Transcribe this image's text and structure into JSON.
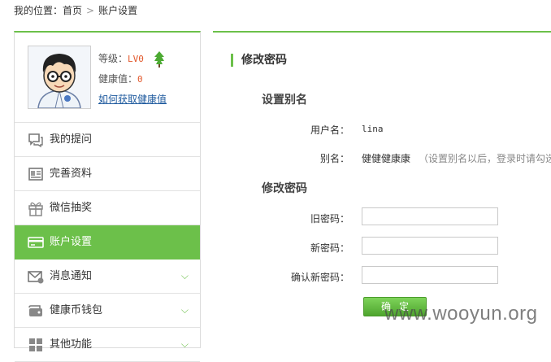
{
  "breadcrumb": {
    "prefix": "我的位置：",
    "home": "首页",
    "separator": ">",
    "current": "账户设置"
  },
  "profile": {
    "level_label": "等级：",
    "level_value": "LV0",
    "health_label": "健康值：",
    "health_value": "0",
    "health_link": "如何获取健康值"
  },
  "menu": [
    {
      "label": "我的提问",
      "icon": "chat-bubble-icon"
    },
    {
      "label": "完善资料",
      "icon": "profile-card-icon"
    },
    {
      "label": "微信抽奖",
      "icon": "gift-icon"
    },
    {
      "label": "账户设置",
      "icon": "credit-card-icon",
      "active": true
    },
    {
      "label": "消息通知",
      "icon": "envelope-icon",
      "expandable": true
    },
    {
      "label": "健康币钱包",
      "icon": "wallet-icon",
      "expandable": true
    },
    {
      "label": "其他功能",
      "icon": "grid-icon",
      "expandable": true
    }
  ],
  "content": {
    "title": "修改密码",
    "alias_section": "设置别名",
    "username_label": "用户名：",
    "username_value": "lina",
    "alias_label": "别名：",
    "alias_value": "健健健康康",
    "alias_hint": "（设置别名以后，登录时请勾选",
    "password_section": "修改密码",
    "old_password_label": "旧密码：",
    "new_password_label": "新密码：",
    "confirm_password_label": "确认新密码：",
    "submit_label": "确定"
  },
  "watermark": "www.wooyun.org",
  "colors": {
    "accent": "#6cc04a",
    "level_text": "#e2592d",
    "link": "#1e5a9e"
  }
}
